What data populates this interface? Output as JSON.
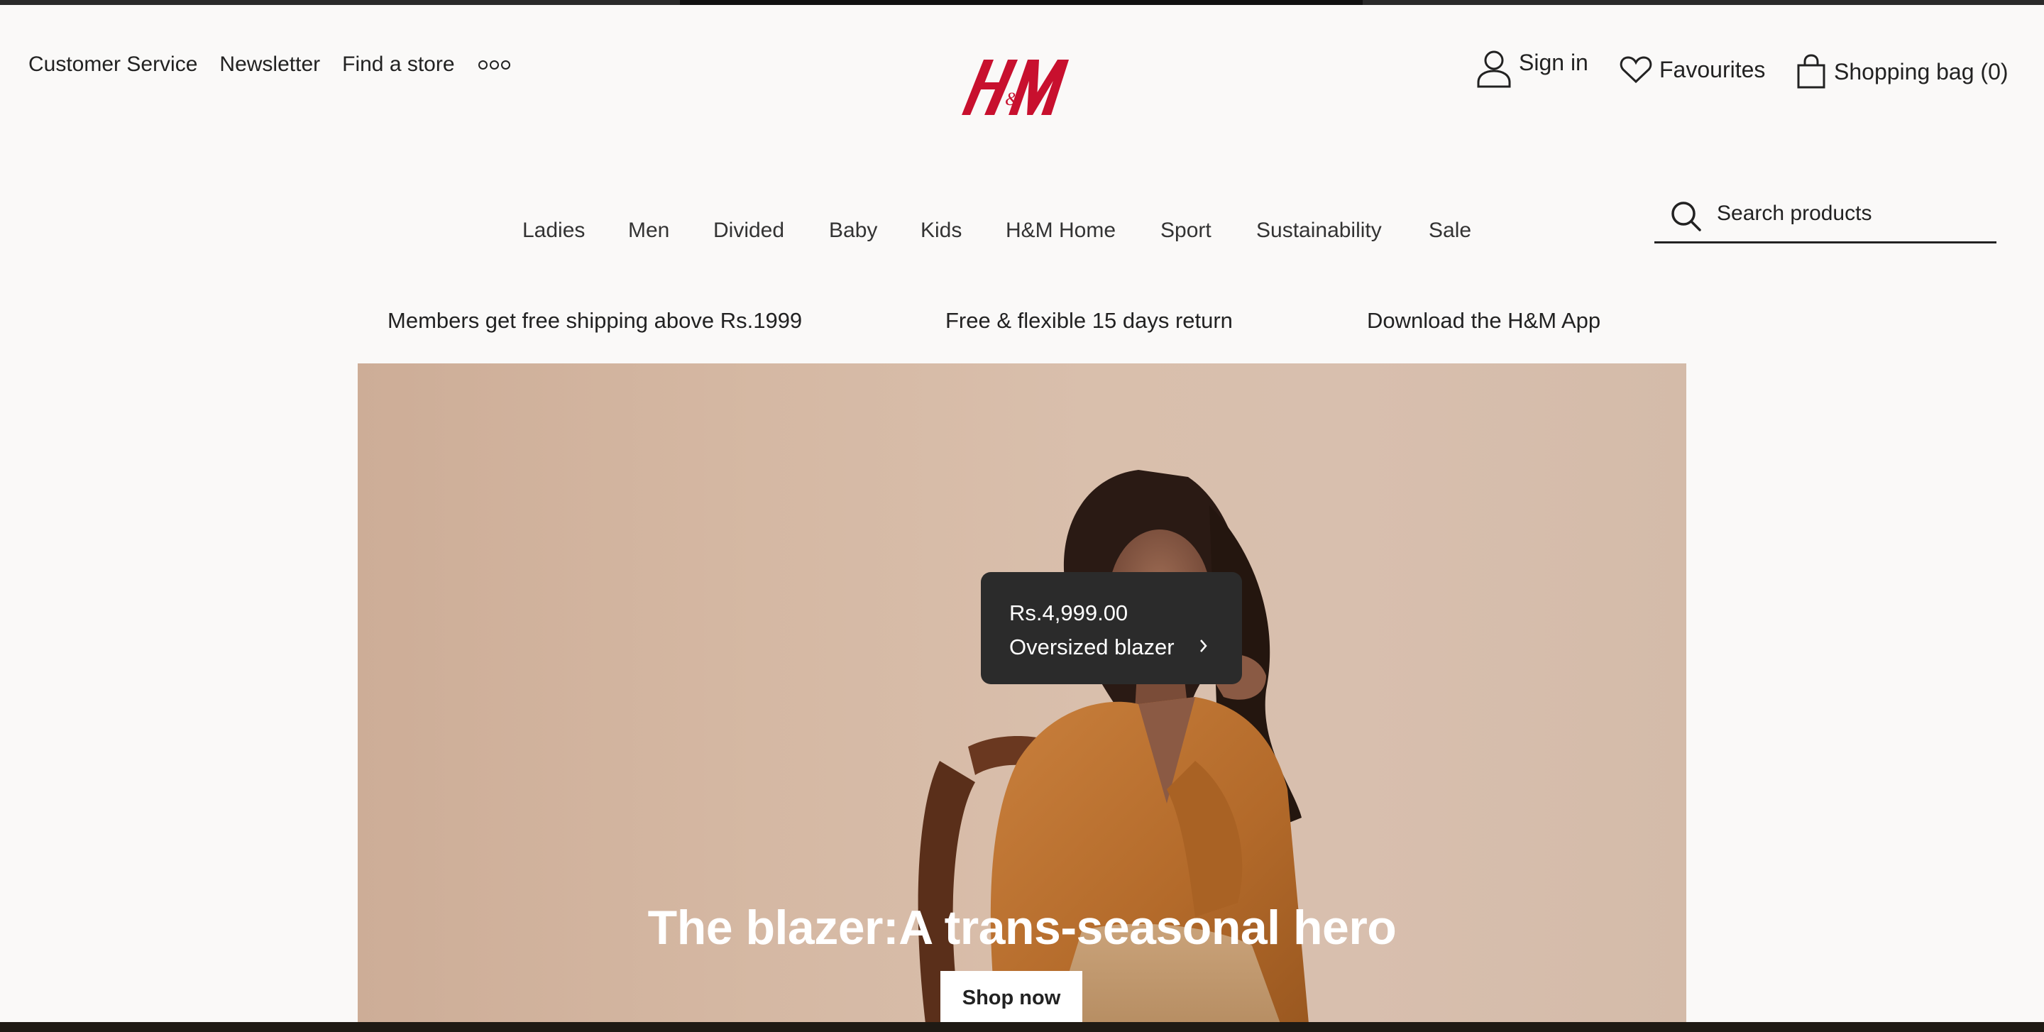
{
  "utility_nav": {
    "customer_service": "Customer Service",
    "newsletter": "Newsletter",
    "find_store": "Find a store"
  },
  "logo_text": "H&M",
  "account": {
    "sign_in": "Sign in",
    "favourites": "Favourites",
    "shopping_bag": "Shopping bag (0)"
  },
  "main_nav": [
    "Ladies",
    "Men",
    "Divided",
    "Baby",
    "Kids",
    "H&M Home",
    "Sport",
    "Sustainability",
    "Sale"
  ],
  "search": {
    "placeholder": "Search products"
  },
  "promos": [
    "Members get free shipping above Rs.1999",
    "Free & flexible 15 days return",
    "Download the H&M App"
  ],
  "hero": {
    "product_price": "Rs.4,999.00",
    "product_name": "Oversized blazer",
    "headline": "The blazer:A trans-seasonal hero",
    "cta": "Shop now"
  },
  "icons": {
    "more": "more-dots-icon",
    "account": "user-icon",
    "favourites": "heart-icon",
    "bag": "shopping-bag-icon",
    "search": "search-icon",
    "chevron": "chevron-right-icon"
  },
  "colors": {
    "brand_red": "#c8102e",
    "page_bg": "#faf9f8",
    "tooltip_bg": "#2b2b2b",
    "hero_bg": "#d4b7a3"
  }
}
